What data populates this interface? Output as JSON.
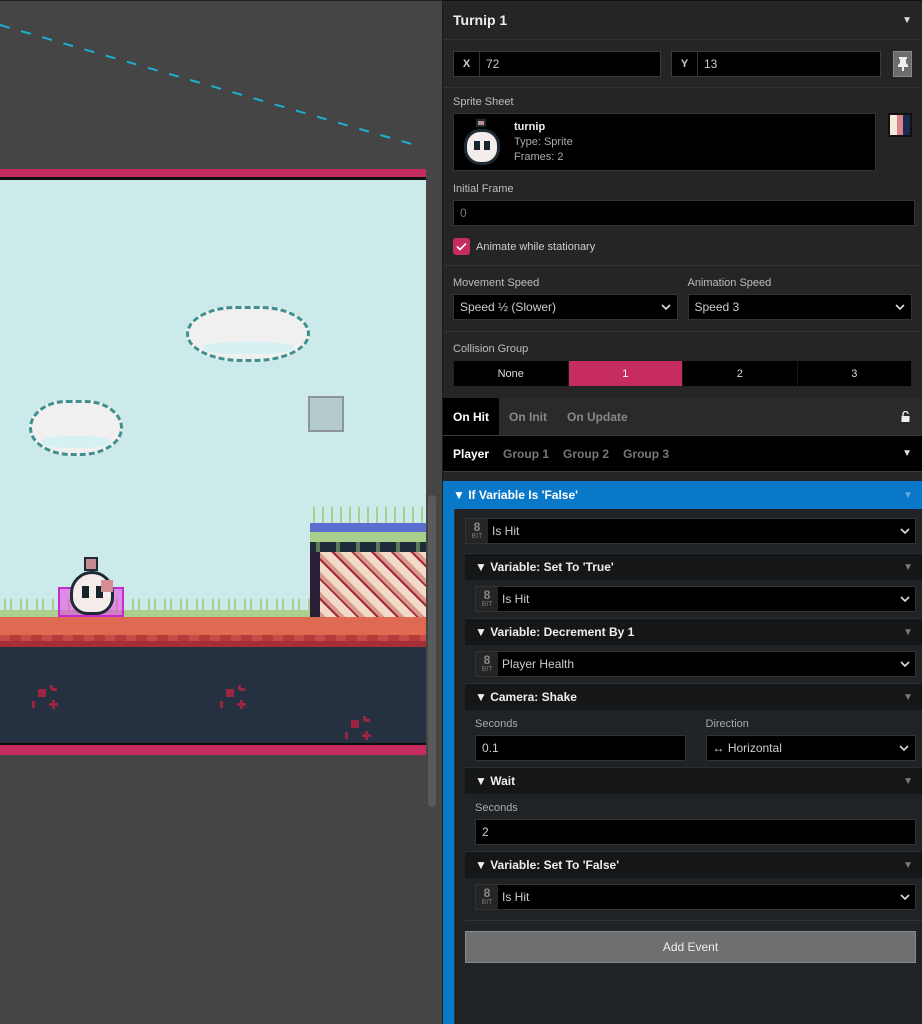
{
  "canvas": {
    "actor_name": "Turnip 1",
    "colors": {
      "scene_border": "#c72c5e",
      "sky": "#cdeaea",
      "ground": "#de6b51",
      "underground": "#253040",
      "connector_line": "#1ab0d0",
      "hitbox": "#c32ad0"
    }
  },
  "inspector": {
    "title": "Turnip 1",
    "x_label": "X",
    "x_value": "72",
    "y_label": "Y",
    "y_value": "13",
    "sprite_sheet": {
      "label": "Sprite Sheet",
      "name": "turnip",
      "type_label": "Type:",
      "type_value": "Sprite",
      "frames_label": "Frames:",
      "frames_value": "2",
      "palette": [
        "#f5ebdc",
        "#d9848a",
        "#1b2a4e"
      ]
    },
    "initial_frame": {
      "label": "Initial Frame",
      "placeholder": "0",
      "value": ""
    },
    "animate_while_stationary": {
      "label": "Animate while stationary",
      "checked": true
    },
    "movement_speed": {
      "label": "Movement Speed",
      "value": "Speed ½ (Slower)"
    },
    "animation_speed": {
      "label": "Animation Speed",
      "value": "Speed 3"
    },
    "collision_group": {
      "label": "Collision Group",
      "options": [
        "None",
        "1",
        "2",
        "3"
      ],
      "selected": "1"
    },
    "script_tabs": [
      "On Hit",
      "On Init",
      "On Update"
    ],
    "active_script_tab": "On Hit",
    "hit_tabs": [
      "Player",
      "Group 1",
      "Group 2",
      "Group 3"
    ],
    "active_hit_tab": "Player",
    "script": {
      "if_title": "If Variable Is 'False'",
      "if_variable": {
        "bits": "8",
        "bits_label": "BIT",
        "value": "Is Hit"
      },
      "events": [
        {
          "title": "Variable: Set To 'True'",
          "variable": "Is Hit"
        },
        {
          "title": "Variable: Decrement By 1",
          "variable": "Player Health"
        },
        {
          "title": "Camera: Shake",
          "seconds_label": "Seconds",
          "seconds": "0.1",
          "direction_label": "Direction",
          "direction": "↔ Horizontal"
        },
        {
          "title": "Wait",
          "seconds_label": "Seconds",
          "seconds": "2"
        },
        {
          "title": "Variable: Set To 'False'",
          "variable": "Is Hit"
        }
      ],
      "add_event_label": "Add Event"
    }
  }
}
